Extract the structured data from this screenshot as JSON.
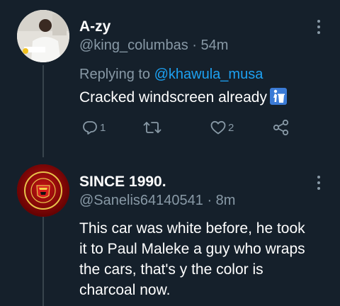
{
  "tweets": [
    {
      "name": "A-zy",
      "handle": "@king_columbas",
      "time": "54m",
      "replying_prefix": "Replying to",
      "replying_to": "@khawula_musa",
      "text": "Cracked windscreen already",
      "emoji": "put-litter-in-its-place-icon",
      "actions": {
        "reply_count": "1",
        "retweet_count": "",
        "like_count": "2"
      }
    },
    {
      "name": "SINCE 1990.",
      "handle": "@Sanelis64140541",
      "time": "8m",
      "text_lines": [
        "This car was white before, he took",
        "it to Paul Maleke a guy who wraps",
        "the cars, that's y the color is",
        "charcoal now."
      ]
    }
  ],
  "colors": {
    "background": "#15202b",
    "secondary_text": "#8899a6",
    "accent": "#1da1f2",
    "thread_line": "#38444d"
  }
}
